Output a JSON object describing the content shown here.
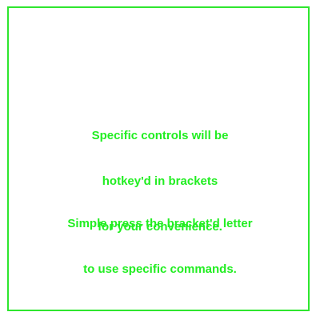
{
  "colors": {
    "border": "#2ee62e",
    "text": "#22ee22",
    "background": "#ffffff"
  },
  "instructions": {
    "paragraph1": [
      "Specific controls will be",
      "hotkey'd in brackets",
      "for your convenience."
    ],
    "paragraph2": [
      "Simple press the bracket'd letter",
      "to use specific commands."
    ]
  }
}
